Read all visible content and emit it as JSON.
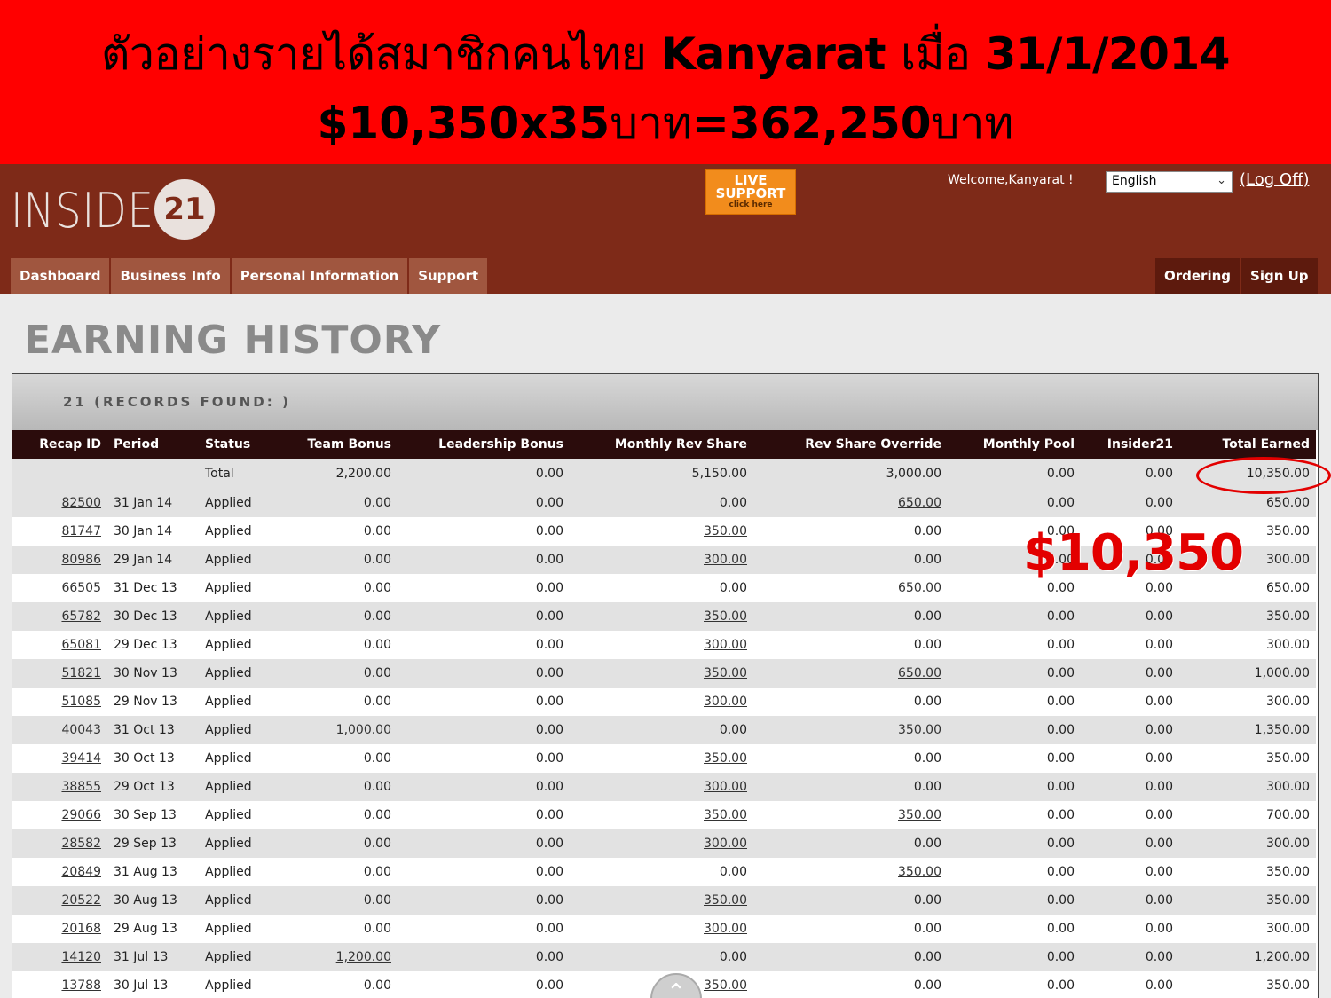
{
  "banner": {
    "line1_thai": "ตัวอย่างรายได้สมาชิกคนไทย",
    "line1_name": "Kanyarat",
    "line1_when": "เมื่อ",
    "line1_date": "31/1/2014",
    "line2_amount": "$10,350x35",
    "line2_unit1": "บาท",
    "line2_result": "=362,250",
    "line2_unit2": "บาท"
  },
  "header": {
    "logo_text": "INSIDER",
    "logo_badge": "21",
    "live_support_line1": "LIVE",
    "live_support_line2": "SUPPORT",
    "live_support_line3": "click here",
    "welcome": "Welcome,Kanyarat !",
    "language": "English",
    "logoff": "(Log Off)"
  },
  "nav": {
    "left": [
      "Dashboard",
      "Business Info",
      "Personal Information",
      "Support"
    ],
    "right": [
      "Ordering",
      "Sign Up"
    ]
  },
  "page": {
    "title": "EARNING HISTORY",
    "records_found": "21 (RECORDS FOUND: )"
  },
  "table": {
    "columns": [
      "Recap ID",
      "Period",
      "Status",
      "Team Bonus",
      "Leadership Bonus",
      "Monthly Rev Share",
      "Rev Share Override",
      "Monthly Pool",
      "Insider21",
      "Total Earned"
    ],
    "total": [
      "",
      "",
      "Total",
      "2,200.00",
      "0.00",
      "5,150.00",
      "3,000.00",
      "0.00",
      "0.00",
      "10,350.00"
    ],
    "rows": [
      [
        "82500",
        "31 Jan 14",
        "Applied",
        "0.00",
        "0.00",
        "0.00",
        "650.00",
        "0.00",
        "0.00",
        "650.00"
      ],
      [
        "81747",
        "30 Jan 14",
        "Applied",
        "0.00",
        "0.00",
        "350.00",
        "0.00",
        "0.00",
        "0.00",
        "350.00"
      ],
      [
        "80986",
        "29 Jan 14",
        "Applied",
        "0.00",
        "0.00",
        "300.00",
        "0.00",
        "0.00",
        "0.00",
        "300.00"
      ],
      [
        "66505",
        "31 Dec 13",
        "Applied",
        "0.00",
        "0.00",
        "0.00",
        "650.00",
        "0.00",
        "0.00",
        "650.00"
      ],
      [
        "65782",
        "30 Dec 13",
        "Applied",
        "0.00",
        "0.00",
        "350.00",
        "0.00",
        "0.00",
        "0.00",
        "350.00"
      ],
      [
        "65081",
        "29 Dec 13",
        "Applied",
        "0.00",
        "0.00",
        "300.00",
        "0.00",
        "0.00",
        "0.00",
        "300.00"
      ],
      [
        "51821",
        "30 Nov 13",
        "Applied",
        "0.00",
        "0.00",
        "350.00",
        "650.00",
        "0.00",
        "0.00",
        "1,000.00"
      ],
      [
        "51085",
        "29 Nov 13",
        "Applied",
        "0.00",
        "0.00",
        "300.00",
        "0.00",
        "0.00",
        "0.00",
        "300.00"
      ],
      [
        "40043",
        "31 Oct 13",
        "Applied",
        "1,000.00",
        "0.00",
        "0.00",
        "350.00",
        "0.00",
        "0.00",
        "1,350.00"
      ],
      [
        "39414",
        "30 Oct 13",
        "Applied",
        "0.00",
        "0.00",
        "350.00",
        "0.00",
        "0.00",
        "0.00",
        "350.00"
      ],
      [
        "38855",
        "29 Oct 13",
        "Applied",
        "0.00",
        "0.00",
        "300.00",
        "0.00",
        "0.00",
        "0.00",
        "300.00"
      ],
      [
        "29066",
        "30 Sep 13",
        "Applied",
        "0.00",
        "0.00",
        "350.00",
        "350.00",
        "0.00",
        "0.00",
        "700.00"
      ],
      [
        "28582",
        "29 Sep 13",
        "Applied",
        "0.00",
        "0.00",
        "300.00",
        "0.00",
        "0.00",
        "0.00",
        "300.00"
      ],
      [
        "20849",
        "31 Aug 13",
        "Applied",
        "0.00",
        "0.00",
        "0.00",
        "350.00",
        "0.00",
        "0.00",
        "350.00"
      ],
      [
        "20522",
        "30 Aug 13",
        "Applied",
        "0.00",
        "0.00",
        "350.00",
        "0.00",
        "0.00",
        "0.00",
        "350.00"
      ],
      [
        "20168",
        "29 Aug 13",
        "Applied",
        "0.00",
        "0.00",
        "300.00",
        "0.00",
        "0.00",
        "0.00",
        "300.00"
      ],
      [
        "14120",
        "31 Jul 13",
        "Applied",
        "1,200.00",
        "0.00",
        "0.00",
        "0.00",
        "0.00",
        "0.00",
        "1,200.00"
      ],
      [
        "13788",
        "30 Jul 13",
        "Applied",
        "0.00",
        "0.00",
        "350.00",
        "0.00",
        "0.00",
        "0.00",
        "350.00"
      ]
    ]
  },
  "annotation": {
    "amount": "$10,350"
  },
  "colors": {
    "banner_red": "#ff0000",
    "header_brown": "#7e2a18",
    "table_head": "#2b0c0c",
    "annotation_red": "#e30000"
  }
}
